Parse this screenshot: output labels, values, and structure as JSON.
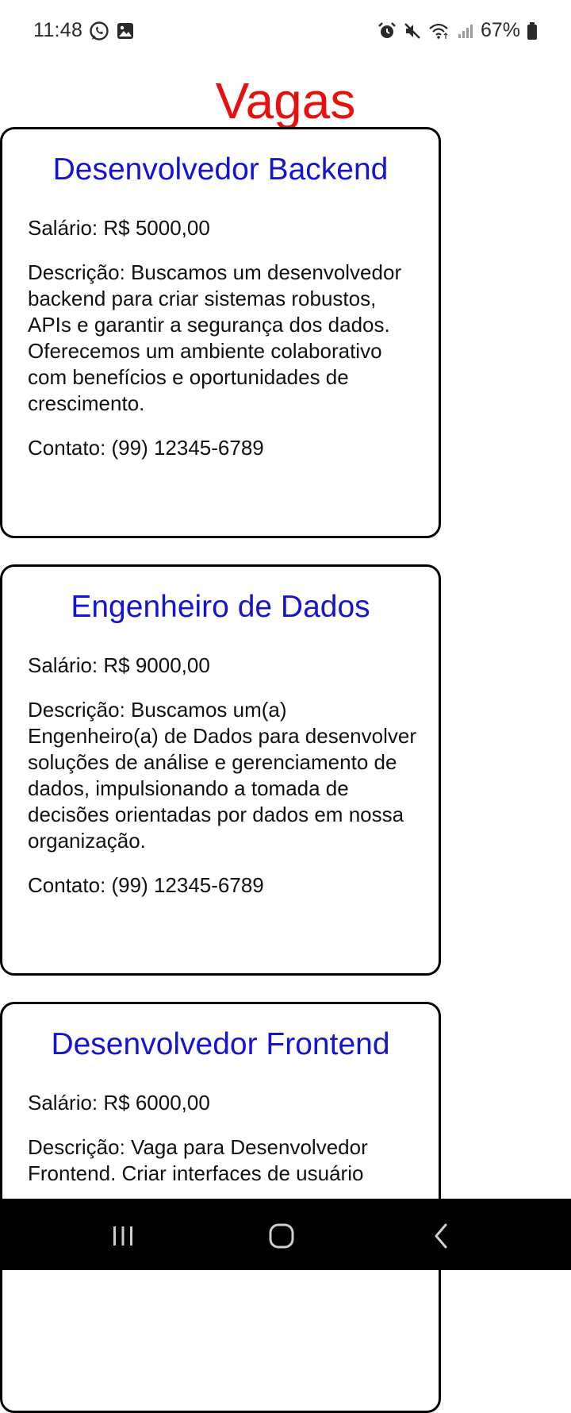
{
  "status_bar": {
    "time": "11:48",
    "left_icons": [
      "whatsapp-icon",
      "gallery-icon"
    ],
    "right_icons": [
      "alarm-icon",
      "mute-icon",
      "wifi-icon",
      "signal-icon",
      "battery-icon"
    ],
    "battery": "67%"
  },
  "page": {
    "title": "Vagas"
  },
  "jobs": [
    {
      "title": "Desenvolvedor Backend",
      "salary": "Salário: R$ 5000,00",
      "description": "Descrição: Buscamos um desenvolvedor backend para criar sistemas robustos, APIs e garantir a segurança dos dados. Oferecemos um ambiente colaborativo com benefícios e oportunidades de crescimento.",
      "contact": "Contato: (99) 12345-6789"
    },
    {
      "title": "Engenheiro de Dados",
      "salary": "Salário: R$ 9000,00",
      "description": "Descrição: Buscamos um(a) Engenheiro(a) de Dados para desenvolver soluções de análise e gerenciamento de dados, impulsionando a tomada de decisões orientadas por dados em nossa organização.",
      "contact": "Contato: (99) 12345-6789"
    },
    {
      "title": "Desenvolvedor Frontend",
      "salary": "Salário: R$ 6000,00",
      "description": "Descrição: Vaga para Desenvolvedor Frontend. Criar interfaces de usuário",
      "contact": ""
    }
  ],
  "nav_bar": {
    "buttons": [
      "recent-apps-icon",
      "home-icon",
      "back-icon"
    ]
  },
  "colors": {
    "title": "#e8100f",
    "job_title": "#1414d2",
    "card_border": "#000000",
    "nav_background": "#000000"
  }
}
